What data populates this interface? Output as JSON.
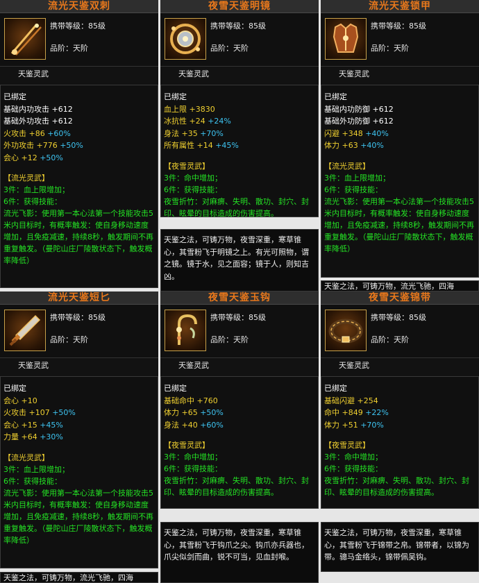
{
  "cards": [
    {
      "title": "流光天鉴双刺",
      "level": "携带等级：85级",
      "grade": "品阶：天阶",
      "set_title": "天鉴灵武",
      "bound": "已绑定",
      "stats": [
        {
          "name": "基础内功攻击",
          "value": "+612",
          "bonus": ""
        },
        {
          "name": "基础外功攻击",
          "value": "+612",
          "bonus": ""
        },
        {
          "name": "火攻击",
          "value": "+86",
          "bonus": "+60%"
        },
        {
          "name": "外功攻击",
          "value": "+776",
          "bonus": "+50%"
        },
        {
          "name": "会心",
          "value": "+12",
          "bonus": "+50%"
        }
      ],
      "set_name": "【流光灵武】",
      "set_lines": [
        "3件：血上限增加；",
        "6件：获得技能：",
        "流光飞影：使用第一本心法第一个技能攻击5米内目标时，有概率触发：使自身移动速度增加，且免疫减速，持续8秒，触发期间不再重复触发。（曼陀山庄厂陵散状态下，触发概率降低）"
      ],
      "icon": "double-dagger-icon"
    },
    {
      "title": "夜雪天鉴明镜",
      "level": "携带等级：85级",
      "grade": "品阶：天阶",
      "set_title": "天鉴灵武",
      "bound": "已绑定",
      "stats": [
        {
          "name": "血上限",
          "value": "+3830",
          "bonus": ""
        },
        {
          "name": "冰抗性",
          "value": "+24",
          "bonus": "+24%"
        },
        {
          "name": "身法",
          "value": "+35",
          "bonus": "+70%"
        },
        {
          "name": "所有属性",
          "value": "+14",
          "bonus": "+45%"
        }
      ],
      "set_name": "【夜雪灵武】",
      "set_lines": [
        "3件：命中增加；",
        "6件：获得技能：",
        "夜雪折竹：对麻痹、失明、散功、封穴、封印、眩晕的目标造成的伤害提高。"
      ],
      "icon": "mirror-icon"
    },
    {
      "title": "流光天鉴锁甲",
      "level": "携带等级：85级",
      "grade": "品阶：天阶",
      "set_title": "天鉴灵武",
      "bound": "已绑定",
      "stats": [
        {
          "name": "基础内功防御",
          "value": "+612",
          "bonus": ""
        },
        {
          "name": "基础外功防御",
          "value": "+612",
          "bonus": ""
        },
        {
          "name": "闪避",
          "value": "+348",
          "bonus": "+40%"
        },
        {
          "name": "体力",
          "value": "+63",
          "bonus": "+40%"
        }
      ],
      "set_name": "【流光灵武】",
      "set_lines": [
        "3件：血上限增加；",
        "6件：获得技能：",
        "流光飞影：使用第一本心法第一个技能攻击5米内目标时，有概率触发：使自身移动速度增加，且免疫减速，持续8秒，触发期间不再重复触发。（曼陀山庄厂陵散状态下，触发概率降低）"
      ],
      "icon": "armor-icon"
    },
    {
      "title": "流光天鉴短匕",
      "level": "携带等级：85级",
      "grade": "品阶：天阶",
      "set_title": "天鉴灵武",
      "bound": "已绑定",
      "stats": [
        {
          "name": "会心",
          "value": "+10",
          "bonus": ""
        },
        {
          "name": "火攻击",
          "value": "+107",
          "bonus": "+50%"
        },
        {
          "name": "会心",
          "value": "+15",
          "bonus": "+45%"
        },
        {
          "name": "力量",
          "value": "+64",
          "bonus": "+30%"
        }
      ],
      "set_name": "【流光灵武】",
      "set_lines": [
        "3件：血上限增加；",
        "6件：获得技能：",
        "流光飞影：使用第一本心法第一个技能攻击5米内目标时，有概率触发：使自身移动速度增加，且免疫减速，持续8秒，触发期间不再重复触发。（曼陀山庄厂陵散状态下，触发概率降低）"
      ],
      "icon": "dagger-icon"
    },
    {
      "title": "夜雪天鉴玉钩",
      "level": "携带等级：85级",
      "grade": "品阶：天阶",
      "set_title": "天鉴灵武",
      "bound": "已绑定",
      "stats": [
        {
          "name": "基础命中",
          "value": "+760",
          "bonus": ""
        },
        {
          "name": "体力",
          "value": "+65",
          "bonus": "+50%"
        },
        {
          "name": "身法",
          "value": "+40",
          "bonus": "+60%"
        }
      ],
      "set_name": "【夜雪灵武】",
      "set_lines": [
        "3件：命中增加；",
        "6件：获得技能：",
        "夜雪折竹：对麻痹、失明、散功、封穴、封印、眩晕的目标造成的伤害提高。"
      ],
      "icon": "hook-icon"
    },
    {
      "title": "夜雪天鉴锦带",
      "level": "携带等级：85级",
      "grade": "品阶：天阶",
      "set_title": "天鉴灵武",
      "bound": "已绑定",
      "stats": [
        {
          "name": "基础闪避",
          "value": "+254",
          "bonus": ""
        },
        {
          "name": "命中",
          "value": "+849",
          "bonus": "+22%"
        },
        {
          "name": "体力",
          "value": "+51",
          "bonus": "+70%"
        }
      ],
      "set_name": "【夜雪灵武】",
      "set_lines": [
        "3件：命中增加；",
        "6件：获得技能：",
        "夜雪折竹：对麻痹、失明、散功、封穴、封印、眩晕的目标造成的伤害提高。"
      ],
      "icon": "belt-icon"
    }
  ],
  "descs": [
    {
      "text": "天鉴之法，可铸万物，夜雪深重，寒草锥心，其雪粉飞于明镜之上。有光可照物，谓之镜。镜于水，见之面容；镜于人，则知吉凶。"
    },
    {
      "text": "天鉴之法，可铸万物，流光飞驰，四海"
    },
    {
      "text": "天鉴之法，可铸万物，夜雪深重，寒草锥心，其雪粉飞于钩爪之尖。钩爪亦兵器也，爪尖似剑而曲，锐不可当，见血封喉。"
    },
    {
      "text": "天鉴之法，可铸万物，夜雪深重，寒草锥心，其雪粉飞于锦带之帛。锦带者，以锦为带。骢马金络头，锦带佩吴钩。"
    },
    {
      "text": "天鉴之法，可铸万物，流光飞驰，四海"
    }
  ]
}
